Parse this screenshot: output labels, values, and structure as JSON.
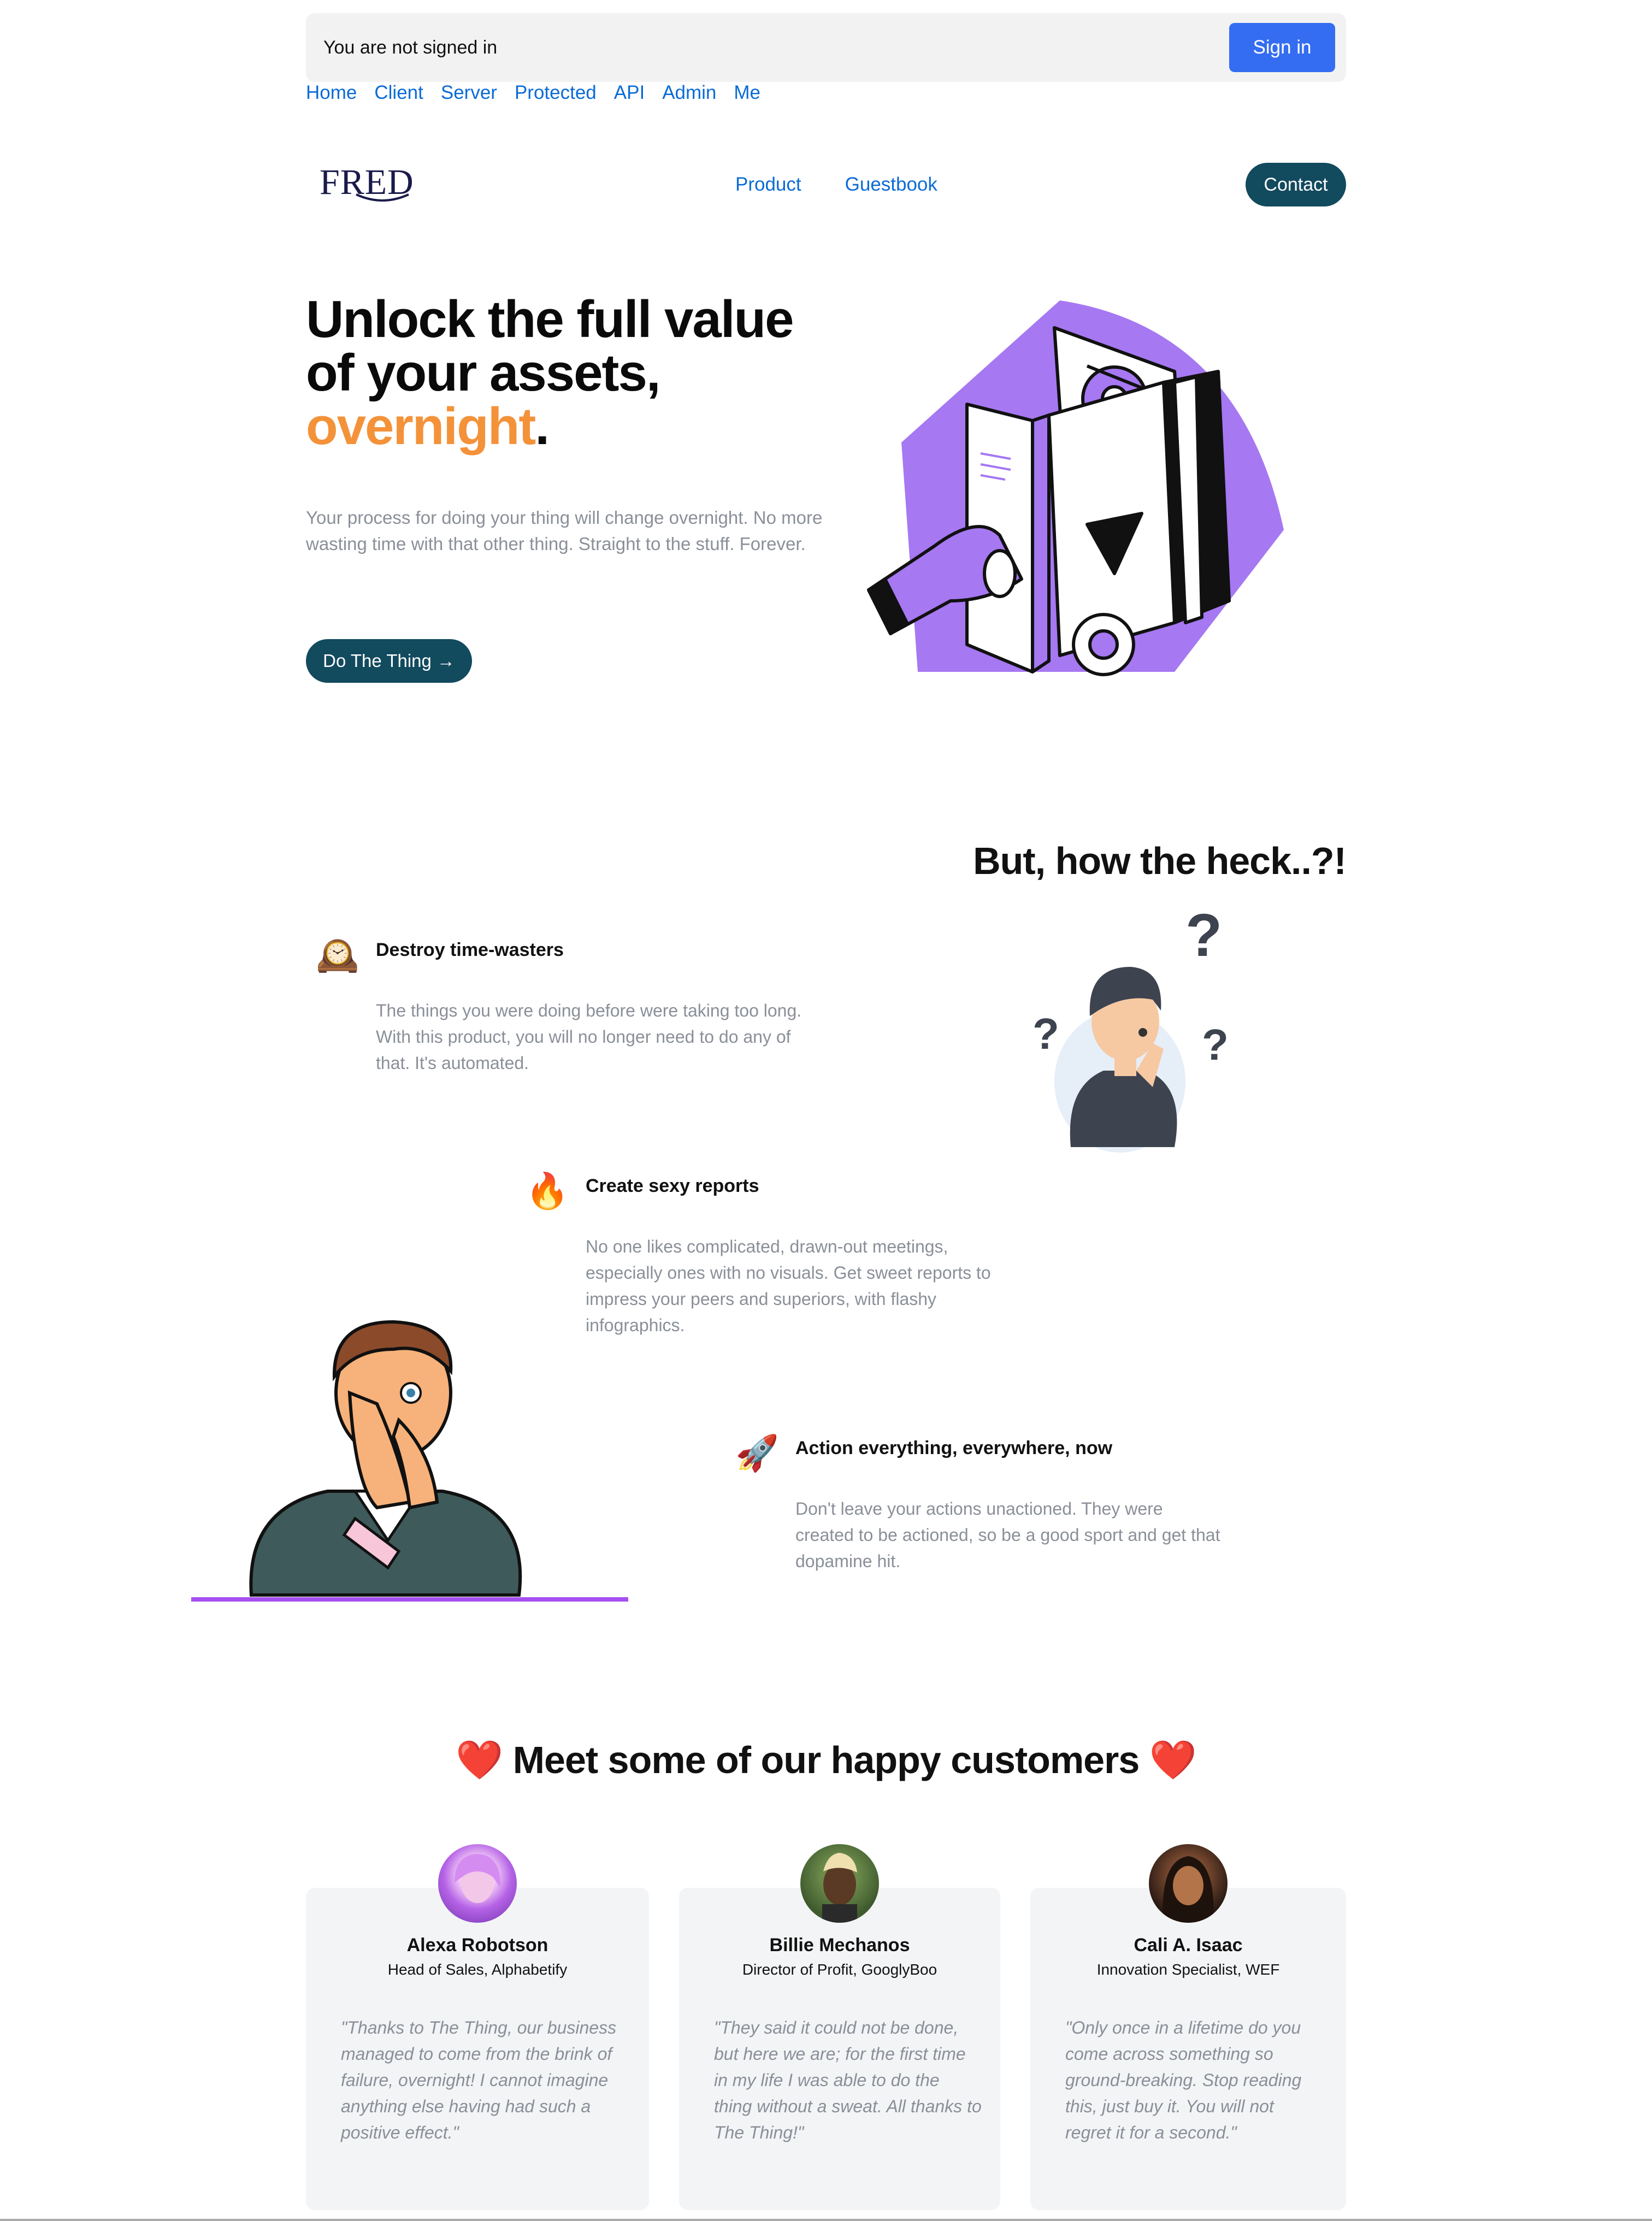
{
  "auth": {
    "status": "You are not signed in",
    "signin_label": "Sign in"
  },
  "debug_nav": [
    "Home",
    "Client",
    "Server",
    "Protected",
    "API",
    "Admin",
    "Me"
  ],
  "nav": {
    "logo": "FRED",
    "links": [
      "Product",
      "Guestbook"
    ],
    "contact_label": "Contact"
  },
  "hero": {
    "title_line1": "Unlock the full value",
    "title_line2": "of your assets,",
    "title_accent": "overnight",
    "title_period": ".",
    "subtitle": "Your process for doing your thing will change overnight. No more wasting time with that other thing. Straight to the stuff. Forever.",
    "cta_label": "Do The Thing",
    "cta_arrow": "→"
  },
  "how": {
    "title": "But, how the heck..?!",
    "features": [
      {
        "icon": "🕰️",
        "icon_name": "mantel-clock-icon",
        "title": "Destroy time-wasters",
        "desc": "The things you were doing before were taking too long. With this product, you will no longer need to do any of that. It's automated."
      },
      {
        "icon": "🔥",
        "icon_name": "fire-icon",
        "title": "Create sexy reports",
        "desc": "No one likes complicated, drawn-out meetings, especially ones with no visuals. Get sweet reports to impress your peers and superiors, with flashy infographics."
      },
      {
        "icon": "🚀",
        "icon_name": "rocket-icon",
        "title": "Action everything, everywhere, now",
        "desc": "Don't leave your actions unactioned. They were created to be actioned, so be a good sport and get that dopamine hit."
      }
    ]
  },
  "customers": {
    "heart": "❤️",
    "title": "Meet some of our happy customers",
    "items": [
      {
        "name": "Alexa Robotson",
        "role": "Head of Sales, Alphabetify",
        "quote": "\"Thanks to The Thing, our business managed to come from the brink of failure, overnight! I cannot imagine anything else having had such a positive effect.\""
      },
      {
        "name": "Billie Mechanos",
        "role": "Director of Profit, GooglyBoo",
        "quote": "\"They said it could not be done, but here we are; for the first time in my life I was able to do the thing without a sweat. All thanks to The Thing!\""
      },
      {
        "name": "Cali A. Isaac",
        "role": "Innovation Specialist, WEF",
        "quote": "\"Only once in a lifetime do you come across something so ground-breaking. Stop reading this, just buy it. You will not regret it for a second.\""
      }
    ]
  },
  "colors": {
    "accent": "#f4923a",
    "primary": "#124a5e",
    "signin": "#346df1",
    "link": "#0a6bd6",
    "purple": "#a678f2"
  }
}
